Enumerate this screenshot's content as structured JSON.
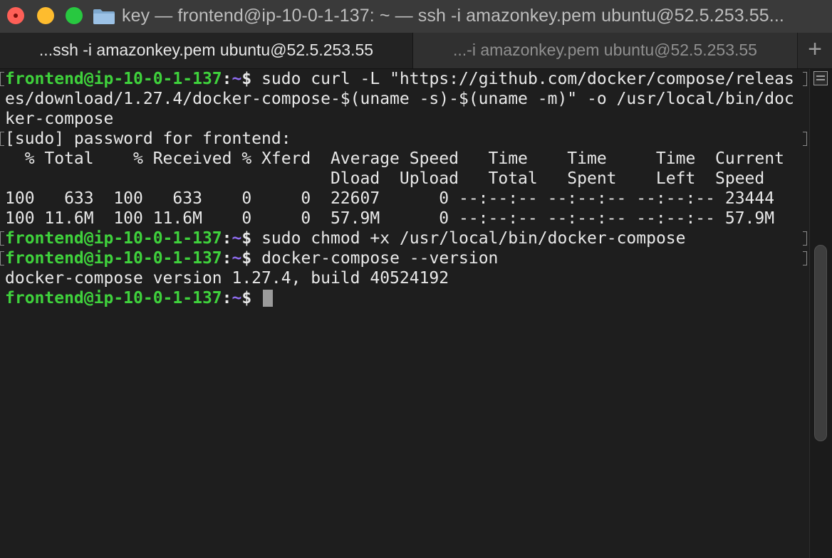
{
  "window": {
    "title": "key — frontend@ip-10-0-1-137: ~ — ssh -i amazonkey.pem ubuntu@52.5.253.55...",
    "folder_icon": "folder-icon"
  },
  "tabs": [
    {
      "label": "...ssh -i amazonkey.pem ubuntu@52.5.253.55",
      "active": true
    },
    {
      "label": "...-i amazonkey.pem ubuntu@52.5.253.55",
      "active": false
    }
  ],
  "new_tab_label": "+",
  "prompt": {
    "user_host": "frontend@ip-10-0-1-137",
    "sep": ":",
    "path": "~",
    "symbol": "$"
  },
  "terminal": {
    "cmd1_line1": " sudo curl -L \"https://github.com/docker/compose/releas",
    "cmd1_line2": "es/download/1.27.4/docker-compose-$(uname -s)-$(uname -m)\" -o /usr/local/bin/doc",
    "cmd1_line3": "ker-compose",
    "sudo_prompt": "[sudo] password for frontend:",
    "curl_header1": "  % Total    % Received % Xferd  Average Speed   Time    Time     Time  Current",
    "curl_header2": "                                 Dload  Upload   Total   Spent    Left  Speed",
    "curl_row1": "100   633  100   633    0     0  22607      0 --:--:-- --:--:-- --:--:-- 23444",
    "curl_row2": "100 11.6M  100 11.6M    0     0  57.9M      0 --:--:-- --:--:-- --:--:-- 57.9M",
    "cmd2": " sudo chmod +x /usr/local/bin/docker-compose",
    "cmd3": " docker-compose --version",
    "version_output": "docker-compose version 1.27.4, build 40524192"
  },
  "scrollbar": {
    "position": 0.58,
    "visible_fraction": 0.42
  }
}
